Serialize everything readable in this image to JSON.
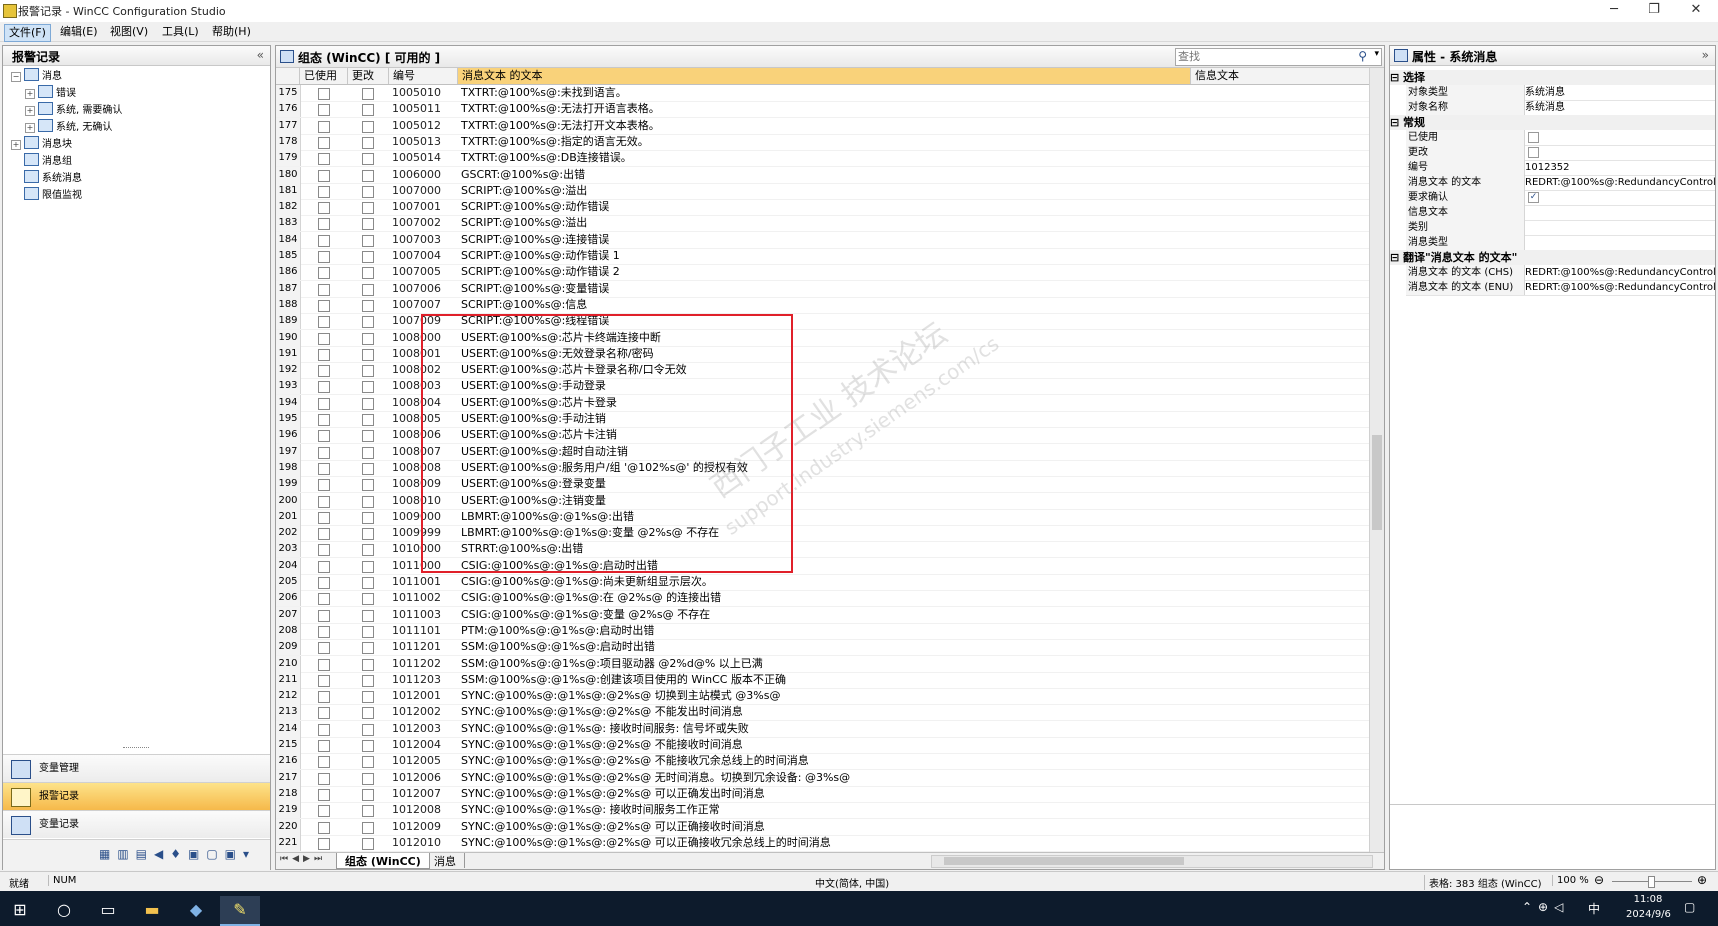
{
  "window": {
    "title": "报警记录 - WinCC Configuration Studio",
    "minimize": "─",
    "maximize": "❐",
    "close": "✕"
  },
  "menu": [
    "文件(F)",
    "编辑(E)",
    "视图(V)",
    "工具(L)",
    "帮助(H)"
  ],
  "left": {
    "title": "报警记录",
    "collapse": "«",
    "tree": [
      {
        "label": "消息",
        "level": 0,
        "expand": "−"
      },
      {
        "label": "错误",
        "level": 1,
        "expand": "+"
      },
      {
        "label": "系统, 需要确认",
        "level": 1,
        "expand": "+"
      },
      {
        "label": "系统, 无确认",
        "level": 1,
        "expand": "+"
      },
      {
        "label": "消息块",
        "level": 0,
        "expand": "+"
      },
      {
        "label": "消息组",
        "level": 0,
        "expand": ""
      },
      {
        "label": "系统消息",
        "level": 0,
        "expand": ""
      },
      {
        "label": "限值监视",
        "level": 0,
        "expand": ""
      }
    ],
    "nav": [
      "变量管理",
      "报警记录",
      "变量记录"
    ]
  },
  "center": {
    "title": "组态 (WinCC) [ 可用的 ]",
    "search_placeholder": "查找",
    "columns": [
      "已使用",
      "更改",
      "编号",
      "消息文本 的文本",
      "信息文本"
    ],
    "rows": [
      [
        "175",
        "1005010",
        "TXTRT:@100%s@:未找到语言。"
      ],
      [
        "176",
        "1005011",
        "TXTRT:@100%s@:无法打开语言表格。"
      ],
      [
        "177",
        "1005012",
        "TXTRT:@100%s@:无法打开文本表格。"
      ],
      [
        "178",
        "1005013",
        "TXTRT:@100%s@:指定的语言无效。"
      ],
      [
        "179",
        "1005014",
        "TXTRT:@100%s@:DB连接错误。"
      ],
      [
        "180",
        "1006000",
        "GSCRT:@100%s@:出错"
      ],
      [
        "181",
        "1007000",
        "SCRIPT:@100%s@:溢出"
      ],
      [
        "182",
        "1007001",
        "SCRIPT:@100%s@:动作错误"
      ],
      [
        "183",
        "1007002",
        "SCRIPT:@100%s@:溢出"
      ],
      [
        "184",
        "1007003",
        "SCRIPT:@100%s@:连接错误"
      ],
      [
        "185",
        "1007004",
        "SCRIPT:@100%s@:动作错误 1"
      ],
      [
        "186",
        "1007005",
        "SCRIPT:@100%s@:动作错误 2"
      ],
      [
        "187",
        "1007006",
        "SCRIPT:@100%s@:变量错误"
      ],
      [
        "188",
        "1007007",
        "SCRIPT:@100%s@:信息"
      ],
      [
        "189",
        "1007009",
        "SCRIPT:@100%s@:线程错误"
      ],
      [
        "190",
        "1008000",
        "USERT:@100%s@:芯片卡终端连接中断"
      ],
      [
        "191",
        "1008001",
        "USERT:@100%s@:无效登录名称/密码"
      ],
      [
        "192",
        "1008002",
        "USERT:@100%s@:芯片卡登录名称/口令无效"
      ],
      [
        "193",
        "1008003",
        "USERT:@100%s@:手动登录"
      ],
      [
        "194",
        "1008004",
        "USERT:@100%s@:芯片卡登录"
      ],
      [
        "195",
        "1008005",
        "USERT:@100%s@:手动注销"
      ],
      [
        "196",
        "1008006",
        "USERT:@100%s@:芯片卡注销"
      ],
      [
        "197",
        "1008007",
        "USERT:@100%s@:超时自动注销"
      ],
      [
        "198",
        "1008008",
        "USERT:@100%s@:服务用户/组 '@102%s@' 的授权有效"
      ],
      [
        "199",
        "1008009",
        "USERT:@100%s@:登录变量"
      ],
      [
        "200",
        "1008010",
        "USERT:@100%s@:注销变量"
      ],
      [
        "201",
        "1009000",
        "LBMRT:@100%s@:@1%s@:出错"
      ],
      [
        "202",
        "1009999",
        "LBMRT:@100%s@:@1%s@:变量 @2%s@ 不存在"
      ],
      [
        "203",
        "1010000",
        "STRRT:@100%s@:出错"
      ],
      [
        "204",
        "1011000",
        "CSIG:@100%s@:@1%s@:启动时出错"
      ],
      [
        "205",
        "1011001",
        "CSIG:@100%s@:@1%s@:尚未更新组显示层次。"
      ],
      [
        "206",
        "1011002",
        "CSIG:@100%s@:@1%s@:在 @2%s@ 的连接出错"
      ],
      [
        "207",
        "1011003",
        "CSIG:@100%s@:@1%s@:变量 @2%s@ 不存在"
      ],
      [
        "208",
        "1011101",
        "PTM:@100%s@:@1%s@:启动时出错"
      ],
      [
        "209",
        "1011201",
        "SSM:@100%s@:@1%s@:启动时出错"
      ],
      [
        "210",
        "1011202",
        "SSM:@100%s@:@1%s@:项目驱动器 @2%d@% 以上已满"
      ],
      [
        "211",
        "1011203",
        "SSM:@100%s@:@1%s@:创建该项目使用的 WinCC 版本不正确"
      ],
      [
        "212",
        "1012001",
        "SYNC:@100%s@:@1%s@:@2%s@ 切换到主站模式 @3%s@"
      ],
      [
        "213",
        "1012002",
        "SYNC:@100%s@:@1%s@:@2%s@ 不能发出时间消息"
      ],
      [
        "214",
        "1012003",
        "SYNC:@100%s@:@1%s@: 接收时间服务: 信号坏或失败"
      ],
      [
        "215",
        "1012004",
        "SYNC:@100%s@:@1%s@:@2%s@ 不能接收时间消息"
      ],
      [
        "216",
        "1012005",
        "SYNC:@100%s@:@1%s@:@2%s@ 不能接收冗余总线上的时间消息"
      ],
      [
        "217",
        "1012006",
        "SYNC:@100%s@:@1%s@:@2%s@ 无时间消息。切换到冗余设备: @3%s@"
      ],
      [
        "218",
        "1012007",
        "SYNC:@100%s@:@1%s@:@2%s@ 可以正确发出时间消息"
      ],
      [
        "219",
        "1012008",
        "SYNC:@100%s@:@1%s@: 接收时间服务工作正常"
      ],
      [
        "220",
        "1012009",
        "SYNC:@100%s@:@1%s@:@2%s@ 可以正确接收时间消息"
      ],
      [
        "221",
        "1012010",
        "SYNC:@100%s@:@1%s@:@2%s@ 可以正确接收冗余总线上的时间消息"
      ]
    ],
    "tabs": [
      "组态 (WinCC)",
      "消息"
    ],
    "watermark": "西门子工业 技术论坛",
    "watermark_url": "support.industry.siemens.com/cs"
  },
  "right": {
    "title": "属性 - 系统消息",
    "collapse": "»",
    "sections": [
      {
        "name": "选择",
        "rows": [
          [
            "对象类型",
            "系统消息",
            ""
          ],
          [
            "对象名称",
            "系统消息",
            ""
          ]
        ]
      },
      {
        "name": "常规",
        "rows": [
          [
            "已使用",
            "",
            "cb0"
          ],
          [
            "更改",
            "",
            "cb0"
          ],
          [
            "编号",
            "1012352",
            ""
          ],
          [
            "消息文本 的文本",
            "REDRT:@100%s@:RedundancyControl",
            ""
          ],
          [
            "要求确认",
            "",
            "cb1"
          ],
          [
            "信息文本",
            "",
            ""
          ],
          [
            "类别",
            "",
            ""
          ],
          [
            "消息类型",
            "",
            ""
          ]
        ]
      },
      {
        "name": "翻译\"消息文本 的文本\"",
        "rows": [
          [
            "消息文本 的文本 (CHS)",
            "REDRT:@100%s@:RedundancyControl",
            ""
          ],
          [
            "消息文本 的文本 (ENU)",
            "REDRT:@100%s@:RedundancyControl",
            ""
          ]
        ]
      }
    ]
  },
  "status": {
    "ready": "就绪",
    "num": "NUM",
    "lang": "中文(简体, 中国)",
    "table": "表格: 383 组态 (WinCC)",
    "zoom": "100 %"
  },
  "taskbar": {
    "ime": "中",
    "time": "11:08",
    "date": "2024/9/6"
  }
}
